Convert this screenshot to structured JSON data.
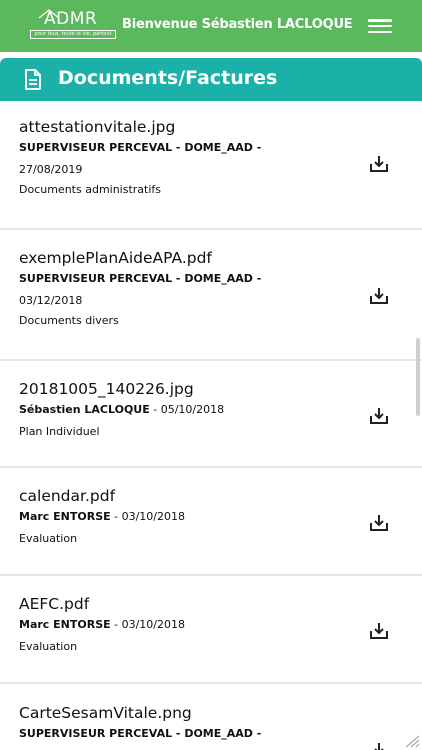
{
  "header": {
    "logo_text": "ADMR",
    "logo_tagline": "pour tous, toute la vie, partout",
    "welcome": "Bienvenue Sébastien LACLOQUE",
    "menu_icon": "hamburger-menu-icon",
    "background": "#5cb85c"
  },
  "section": {
    "icon": "document-icon",
    "title": "Documents/Factures",
    "background": "#1bb0a8"
  },
  "documents": [
    {
      "name": "attestationvitale.jpg",
      "author": "SUPERVISEUR PERCEVAL - DOME_AAD -",
      "date": "27/08/2019",
      "category": "Documents administratifs",
      "action_icon": "download-icon"
    },
    {
      "name": "exemplePlanAideAPA.pdf",
      "author": "SUPERVISEUR PERCEVAL - DOME_AAD -",
      "date": "03/12/2018",
      "category": "Documents divers",
      "action_icon": "download-icon"
    },
    {
      "name": "20181005_140226.jpg",
      "author": "Sébastien LACLOQUE",
      "date": " - 05/10/2018",
      "category": "Plan Individuel",
      "action_icon": "download-icon"
    },
    {
      "name": "calendar.pdf",
      "author": "Marc ENTORSE",
      "date": " - 03/10/2018",
      "category": "Evaluation",
      "action_icon": "download-icon"
    },
    {
      "name": "AEFC.pdf",
      "author": "Marc ENTORSE",
      "date": " - 03/10/2018",
      "category": "Evaluation",
      "action_icon": "download-icon"
    },
    {
      "name": "CarteSesamVitale.png",
      "author": "SUPERVISEUR PERCEVAL - DOME_AAD -",
      "action_icon": "download-icon"
    }
  ]
}
